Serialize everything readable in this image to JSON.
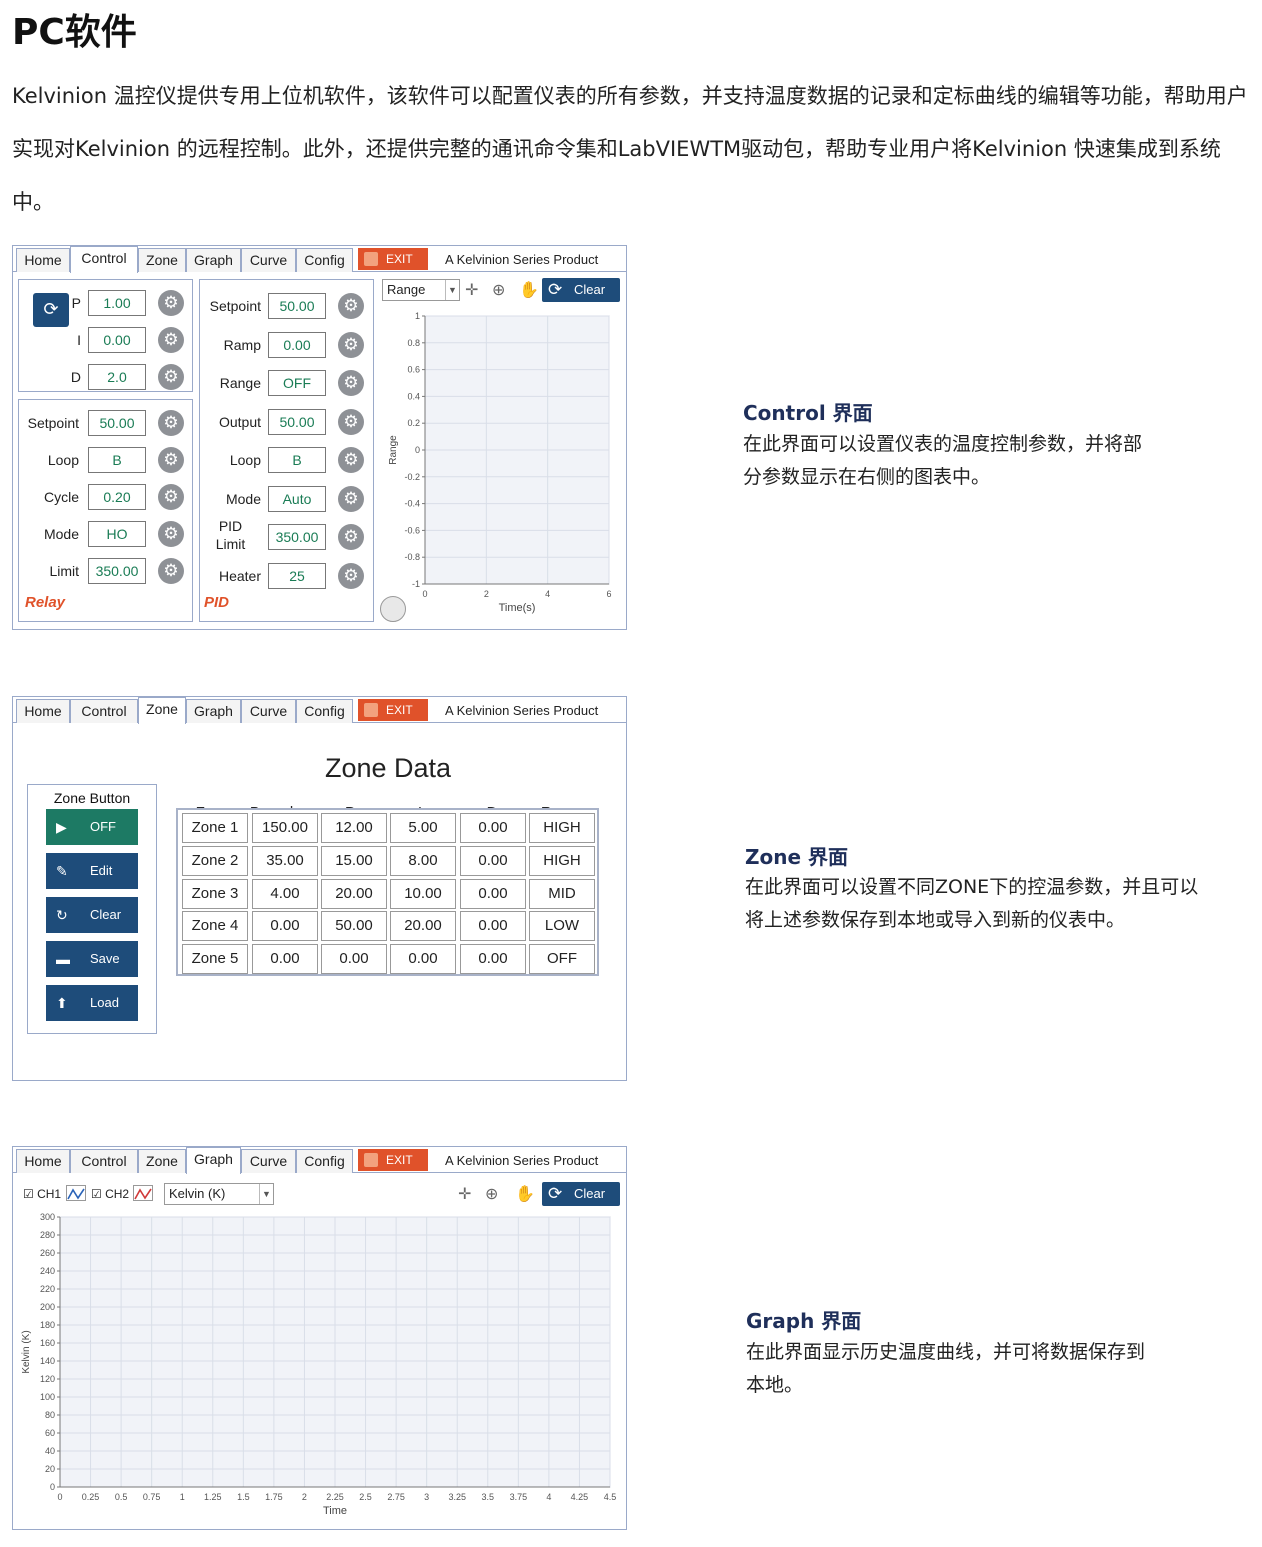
{
  "heading": "PC软件",
  "intro": "Kelvinion 温控仪提供专用上位机软件，该软件可以配置仪表的所有参数，并支持温度数据的记录和定标曲线的编辑等功能，帮助用户实现对Kelvinion 的远程控制。此外，还提供完整的通讯命令集和LabVIEWTM驱动包，帮助专业用户将Kelvinion 快速集成到系统中。",
  "tabs": [
    "Home",
    "Control",
    "Zone",
    "Graph",
    "Curve",
    "Config"
  ],
  "exit_label": "EXIT",
  "series_label": "A Kelvinion Series Product",
  "clear_label": "Clear",
  "control": {
    "pid_rows": [
      {
        "label": "P",
        "value": "1.00"
      },
      {
        "label": "I",
        "value": "0.00"
      },
      {
        "label": "D",
        "value": "2.0"
      }
    ],
    "relay_rows": [
      {
        "label": "Setpoint",
        "value": "50.00"
      },
      {
        "label": "Loop",
        "value": "B"
      },
      {
        "label": "Cycle",
        "value": "0.20"
      },
      {
        "label": "Mode",
        "value": "HO"
      },
      {
        "label": "Limit",
        "value": "350.00"
      }
    ],
    "relay_title": "Relay",
    "mid_rows": [
      {
        "label": "Setpoint",
        "value": "50.00"
      },
      {
        "label": "Ramp",
        "value": "0.00"
      },
      {
        "label": "Range",
        "value": "OFF"
      },
      {
        "label": "Output",
        "value": "50.00"
      },
      {
        "label": "Loop",
        "value": "B"
      },
      {
        "label": "Mode",
        "value": "Auto"
      },
      {
        "label": "PID\nLimit",
        "value": "350.00"
      },
      {
        "label": "Heater",
        "value": "25"
      }
    ],
    "pid_title": "PID",
    "chart_select": "Range"
  },
  "zone": {
    "title": "Zone Data",
    "button_group_title": "Zone Button",
    "buttons": [
      {
        "label": "OFF",
        "icon": "play-icon",
        "glyph": "▶"
      },
      {
        "label": "Edit",
        "icon": "pencil-icon",
        "glyph": "✎"
      },
      {
        "label": "Clear",
        "icon": "refresh-icon",
        "glyph": "↻"
      },
      {
        "label": "Save",
        "icon": "folder-icon",
        "glyph": "▬"
      },
      {
        "label": "Load",
        "icon": "upload-icon",
        "glyph": "⬆"
      }
    ],
    "headers": [
      "Zone",
      "Boundary",
      "P",
      "I",
      "D",
      "Range"
    ],
    "rows": [
      [
        "Zone 1",
        "150.00",
        "12.00",
        "5.00",
        "0.00",
        "HIGH"
      ],
      [
        "Zone 2",
        "35.00",
        "15.00",
        "8.00",
        "0.00",
        "HIGH"
      ],
      [
        "Zone 3",
        "4.00",
        "20.00",
        "10.00",
        "0.00",
        "MID"
      ],
      [
        "Zone 4",
        "0.00",
        "50.00",
        "20.00",
        "0.00",
        "LOW"
      ],
      [
        "Zone 5",
        "0.00",
        "0.00",
        "0.00",
        "0.00",
        "OFF"
      ]
    ]
  },
  "graph": {
    "ch1": "CH1",
    "ch2": "CH2",
    "unit_select": "Kelvin (K)"
  },
  "descriptions": [
    {
      "title": "Control 界面",
      "text": "在此界面可以设置仪表的温度控制参数，并将部分参数显示在右侧的图表中。"
    },
    {
      "title": "Zone 界面",
      "text": "在此界面可以设置不同ZONE下的控温参数，并且可以将上述参数保存到本地或导入到新的仪表中。"
    },
    {
      "title": "Graph 界面",
      "text": "在此界面显示历史温度曲线，并可将数据保存到本地。"
    }
  ],
  "chart_data": [
    {
      "type": "line",
      "series": [],
      "xlabel": "Time(s)",
      "ylabel": "Range",
      "xlim": [
        0,
        6
      ],
      "ylim": [
        -1,
        1
      ],
      "x_ticks": [
        "0",
        "2",
        "4",
        "6"
      ],
      "y_ticks": [
        "1",
        "0.8",
        "0.6",
        "0.4",
        "0.2",
        "0",
        "-0.2",
        "-0.4",
        "-0.6",
        "-0.8",
        "-1"
      ],
      "grid": true
    },
    {
      "type": "line",
      "series": [],
      "xlabel": "Time",
      "ylabel": "Kelvin (K)",
      "xlim": [
        0,
        4.5
      ],
      "ylim": [
        0,
        300
      ],
      "x_ticks": [
        "0",
        "0.25",
        "0.5",
        "0.75",
        "1",
        "1.25",
        "1.5",
        "1.75",
        "2",
        "2.25",
        "2.5",
        "2.75",
        "3",
        "3.25",
        "3.5",
        "3.75",
        "4",
        "4.25",
        "4.5"
      ],
      "y_ticks": [
        "300",
        "280",
        "260",
        "240",
        "220",
        "200",
        "180",
        "160",
        "140",
        "120",
        "100",
        "80",
        "60",
        "40",
        "20",
        "0"
      ],
      "grid": true
    }
  ]
}
